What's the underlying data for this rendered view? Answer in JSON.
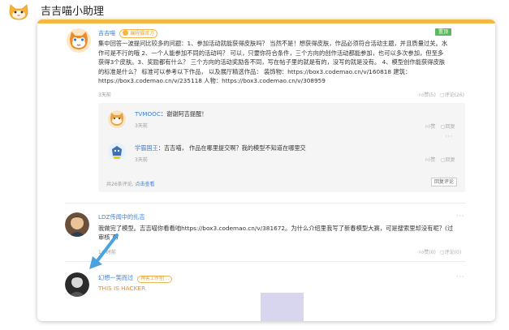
{
  "app": {
    "title": "吉吉喵小助理"
  },
  "post": {
    "author": "吉吉喵",
    "badge": "编程猫官方",
    "tag": "置顶",
    "body": "集中回答一波提问比较多的问题：1、参加活动就能获得皮肤吗？ 当然不是！想获得皮肤，作品必须符合活动主题，并且质量过关。水作可是不行的哦 2、一个人能参加不同的活动吗？ 可以，只要你符合条件，三个方向的创作活动都能参加，也可以多次参加，但至多获得3个皮肤。3、奖励都有什么？ 三个方向的活动奖励各不同，写在帖子里的就是有的，没写的就是没有。 4、模型创作能获得皮肤的标准是什么？ 标准可以参考以下作品， 以及展厅精选作品： 装饰物：https://box3.codemao.cn/v/160818 建筑：https://box3.codemao.cn/v/235118 人物：https://box3.codemao.cn/v/308959",
    "time": "3天前",
    "likes": "赞(5)",
    "comments": "评论(26)"
  },
  "replies": [
    {
      "name": "TVMOOC",
      "text": "：谢谢阿吉提醒！",
      "time": "3天前",
      "like": "赞",
      "reply": "回复"
    },
    {
      "name": "学霸国王",
      "text": "：吉吉喵， 作品在哪里提交啊？我的模型不知道在哪里交",
      "time": "3天前",
      "like": "赞",
      "reply": "回复"
    }
  ],
  "reply_footer": {
    "count": "共26条评论,",
    "view": "点击查看",
    "button": "回复评论"
  },
  "comment2": {
    "name": "LDZ传闻中的扎吉",
    "body": "我做完了模型。吉吉喵你看看咱https://box3.codemao.cn/v/381672。为什么介绍里我写了新春模型大赛，可是搜索里却没有呢？(过审核了)",
    "time": "1小时前",
    "likes": "赞(0)",
    "comments": "评论(0)"
  },
  "comment3": {
    "name": "幻想一笑而过",
    "badge": "神客工作室[...",
    "body": "THIS IS HACKER"
  },
  "icons": {
    "logo": "cat-logo-icon",
    "like": "thumb-up-icon",
    "comment": "comment-icon",
    "more": "more-dots-icon",
    "arrow": "arrow-icon"
  },
  "colors": {
    "accent": "#f5b642",
    "link": "#3d7fd6",
    "top_tag": "#5cb85c",
    "arrow": "#4aa3df",
    "hacker": "#f08a24"
  }
}
